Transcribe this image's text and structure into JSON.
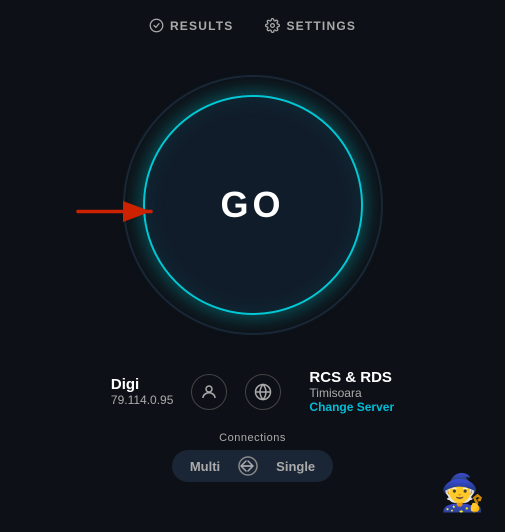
{
  "nav": {
    "results_label": "RESULTS",
    "settings_label": "SETTINGS"
  },
  "go_button": {
    "label": "GO"
  },
  "isp": {
    "name": "Digi",
    "ip": "79.114.0.95"
  },
  "server": {
    "name": "RCS & RDS",
    "city": "Timisoara",
    "change_label": "Change Server"
  },
  "connections": {
    "label": "Connections",
    "multi": "Multi",
    "single": "Single"
  }
}
